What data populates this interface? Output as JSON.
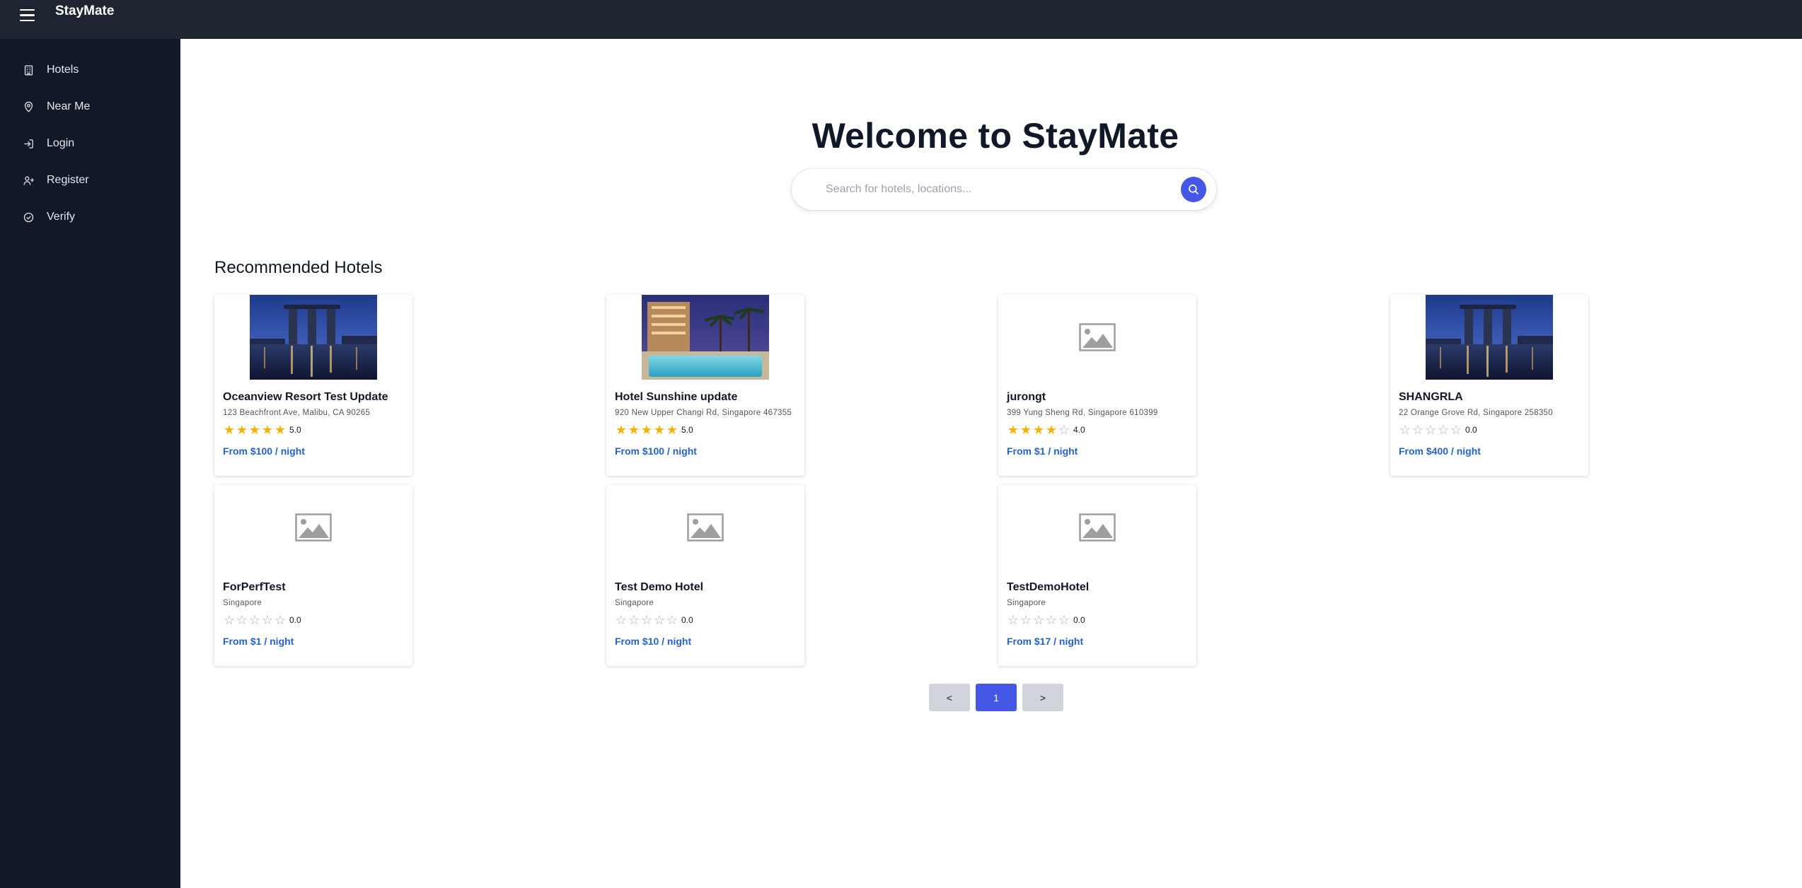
{
  "app": {
    "brand": "StayMate"
  },
  "sidebar": {
    "items": [
      {
        "label": "Hotels",
        "icon": "building-icon"
      },
      {
        "label": "Near Me",
        "icon": "map-pin-icon"
      },
      {
        "label": "Login",
        "icon": "login-icon"
      },
      {
        "label": "Register",
        "icon": "user-plus-icon"
      },
      {
        "label": "Verify",
        "icon": "check-circle-icon"
      }
    ]
  },
  "hero": {
    "title": "Welcome to StayMate",
    "search_placeholder": "Search for hotels, locations..."
  },
  "section": {
    "title": "Recommended Hotels"
  },
  "hotels": [
    {
      "name": "Oceanview Resort Test Update",
      "address": "123 Beachfront Ave, Malibu, CA 90265",
      "rating": 5,
      "score": "5.0",
      "price": "From $100 / night",
      "image": "city-skyline"
    },
    {
      "name": "Hotel Sunshine update",
      "address": "920 New Upper Changi Rd, Singapore 467355",
      "rating": 5,
      "score": "5.0",
      "price": "From $100 / night",
      "image": "pool-palms"
    },
    {
      "name": "jurongt",
      "address": "399 Yung Sheng Rd, Singapore 610399",
      "rating": 4,
      "score": "4.0",
      "price": "From $1 / night",
      "image": "placeholder"
    },
    {
      "name": "SHANGRLA",
      "address": "22 Orange Grove Rd, Singapore 258350",
      "rating": 0,
      "score": "0.0",
      "price": "From $400 / night",
      "image": "city-skyline"
    },
    {
      "name": "ForPerfTest",
      "address": "Singapore",
      "rating": 0,
      "score": "0.0",
      "price": "From $1 / night",
      "image": "placeholder"
    },
    {
      "name": "Test Demo Hotel",
      "address": "Singapore",
      "rating": 0,
      "score": "0.0",
      "price": "From $10 / night",
      "image": "placeholder"
    },
    {
      "name": "TestDemoHotel",
      "address": "Singapore",
      "rating": 0,
      "score": "0.0",
      "price": "From $17 / night",
      "image": "placeholder"
    }
  ],
  "pagination": {
    "prev": "<",
    "current": "1",
    "next": ">"
  },
  "colors": {
    "topbar": "#1f2431",
    "sidebar": "#111827",
    "accent": "#4457e6",
    "price": "#2563c9",
    "star": "#f5b301"
  }
}
